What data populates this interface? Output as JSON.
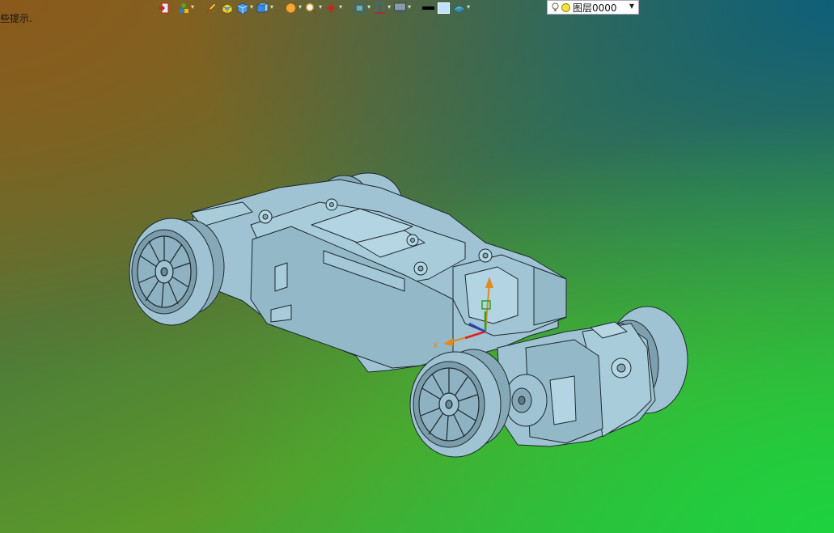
{
  "status": {
    "hint_text": "些提示."
  },
  "toolbar": {
    "buttons": [
      {
        "icon": "exit-icon",
        "has_dropdown": false
      },
      {
        "icon": "feature-tree-icon",
        "has_dropdown": true
      },
      {
        "icon": "pencil-icon",
        "has_dropdown": false
      },
      {
        "icon": "box-yellow-icon",
        "has_dropdown": false
      },
      {
        "icon": "cube-icon",
        "has_dropdown": true
      },
      {
        "icon": "cube-view-icon",
        "has_dropdown": true
      },
      {
        "icon": "render-sphere-icon",
        "has_dropdown": true
      },
      {
        "icon": "zoom-icon",
        "has_dropdown": true
      },
      {
        "icon": "pan-rotate-icon",
        "has_dropdown": true
      },
      {
        "icon": "fit-view-icon",
        "has_dropdown": true
      },
      {
        "icon": "section-view-icon",
        "has_dropdown": true
      },
      {
        "icon": "display-mode-icon",
        "has_dropdown": true
      },
      {
        "icon": "line-color-icon",
        "has_dropdown": false
      },
      {
        "icon": "face-color-icon",
        "has_dropdown": false
      },
      {
        "icon": "material-icon",
        "has_dropdown": true
      }
    ],
    "layer": {
      "value": "图层0000",
      "bulb_icon": "bulb-icon",
      "status_icon": "layer-on-icon"
    }
  },
  "colors": {
    "model_fill": "#9fc3d2",
    "model_edge": "#1d2a30",
    "axis_x": "#e0201a",
    "axis_y": "#2aa02a",
    "axis_z": "#3040c0",
    "triad_orange": "#e08a20"
  }
}
